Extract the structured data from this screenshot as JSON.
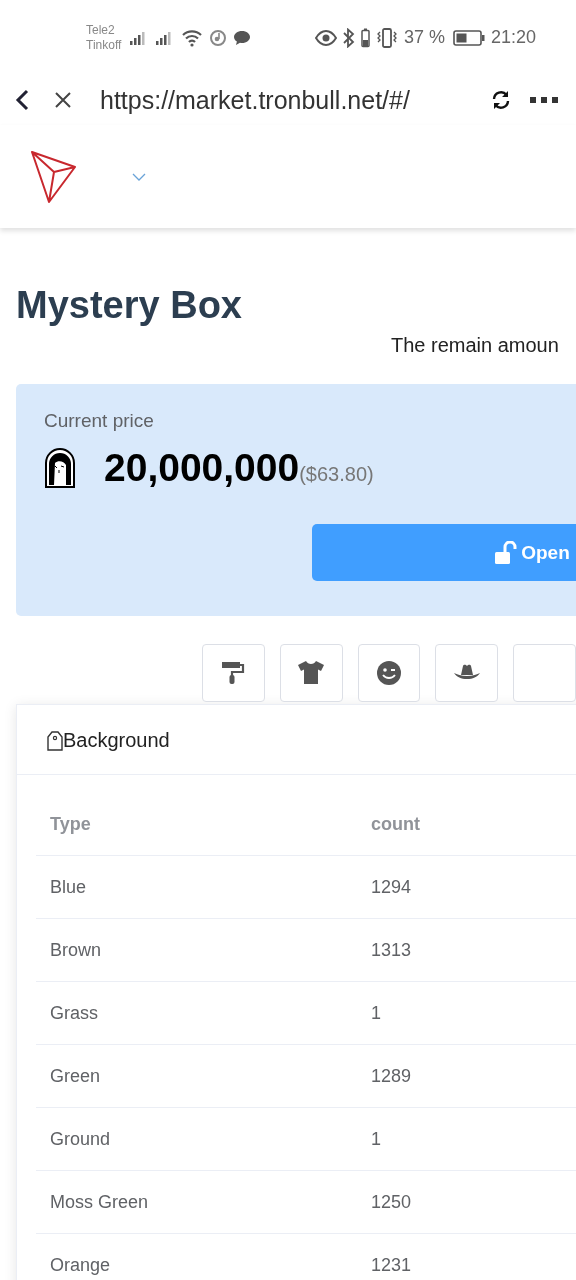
{
  "status_bar": {
    "carrier_1": "Tele2",
    "carrier_2": "Tinkoff",
    "battery_percent": "37 %",
    "time": "21:20"
  },
  "browser": {
    "url": "https://market.tronbull.net/#/"
  },
  "page": {
    "title": "Mystery Box",
    "remain_label": "The remain amoun",
    "price_label": "Current price",
    "price": "20,000,000",
    "price_usd": "($63.80)",
    "open_button": "Open"
  },
  "categories": [
    {
      "kind": "roller"
    },
    {
      "kind": "shirt"
    },
    {
      "kind": "face"
    },
    {
      "kind": "hat"
    },
    {
      "kind": "unknown"
    }
  ],
  "attribute_table": {
    "title": "Background",
    "columns": [
      "Type",
      "count"
    ],
    "rows": [
      [
        "Blue",
        "1294"
      ],
      [
        "Brown",
        "1313"
      ],
      [
        "Grass",
        "1"
      ],
      [
        "Green",
        "1289"
      ],
      [
        "Ground",
        "1"
      ],
      [
        "Moss Green",
        "1250"
      ],
      [
        "Orange",
        "1231"
      ]
    ]
  }
}
